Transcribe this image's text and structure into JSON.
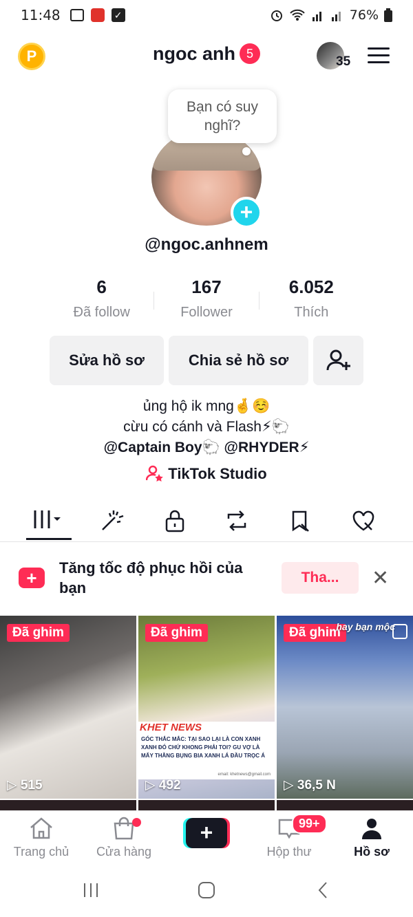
{
  "status": {
    "time": "11:48",
    "battery": "76%"
  },
  "header": {
    "points_label": "P",
    "username": "ngoc anh",
    "notification_count": "5",
    "friends_count": "35"
  },
  "profile": {
    "bubble_text": "Bạn có suy nghĩ?",
    "add_label": "+",
    "handle": "@ngoc.anhnem",
    "stats": [
      {
        "value": "6",
        "label": "Đã follow"
      },
      {
        "value": "167",
        "label": "Follower"
      },
      {
        "value": "6.052",
        "label": "Thích"
      }
    ],
    "buttons": {
      "edit": "Sửa hồ sơ",
      "share": "Chia sẻ hồ sơ"
    },
    "bio": {
      "line1": "ủng hộ ik mng🤞☺️",
      "line2": "cừu có cánh và Flash⚡🐑",
      "line3": "@Captain Boy🐑 @RHYDER⚡"
    },
    "studio_label": "TikTok Studio"
  },
  "banner": {
    "text": "Tăng tốc độ phục hồi của bạn",
    "button": "Tha...",
    "close": "✕"
  },
  "videos": [
    {
      "pinned": "Đã ghim",
      "views": "515"
    },
    {
      "pinned": "Đã ghim",
      "views": "492",
      "news_title": "KHET NEWS",
      "news_body": "GÓC THẮC MẮC: TẠI SAO LẠI LÀ CON XANH XANH ĐÓ CHỨ KHONG PHẢI TOI? GU VỢ LÀ MẤY THẰNG BỤNG BIA XANH LÁ ĐẦU TRỌC Á",
      "news_email": "email: khetnews@gmail.com"
    },
    {
      "pinned": "Đã ghim",
      "views": "36,5 N",
      "overlay": "hay bạn mộc"
    }
  ],
  "bottom_nav": {
    "home": "Trang chủ",
    "shop": "Cửa hàng",
    "create": "+",
    "inbox": "Hộp thư",
    "inbox_badge": "99+",
    "profile": "Hồ sơ"
  },
  "colors": {
    "accent": "#fe2c55",
    "cyan": "#25f4ee",
    "text": "#161823",
    "muted": "#8a8b91"
  }
}
